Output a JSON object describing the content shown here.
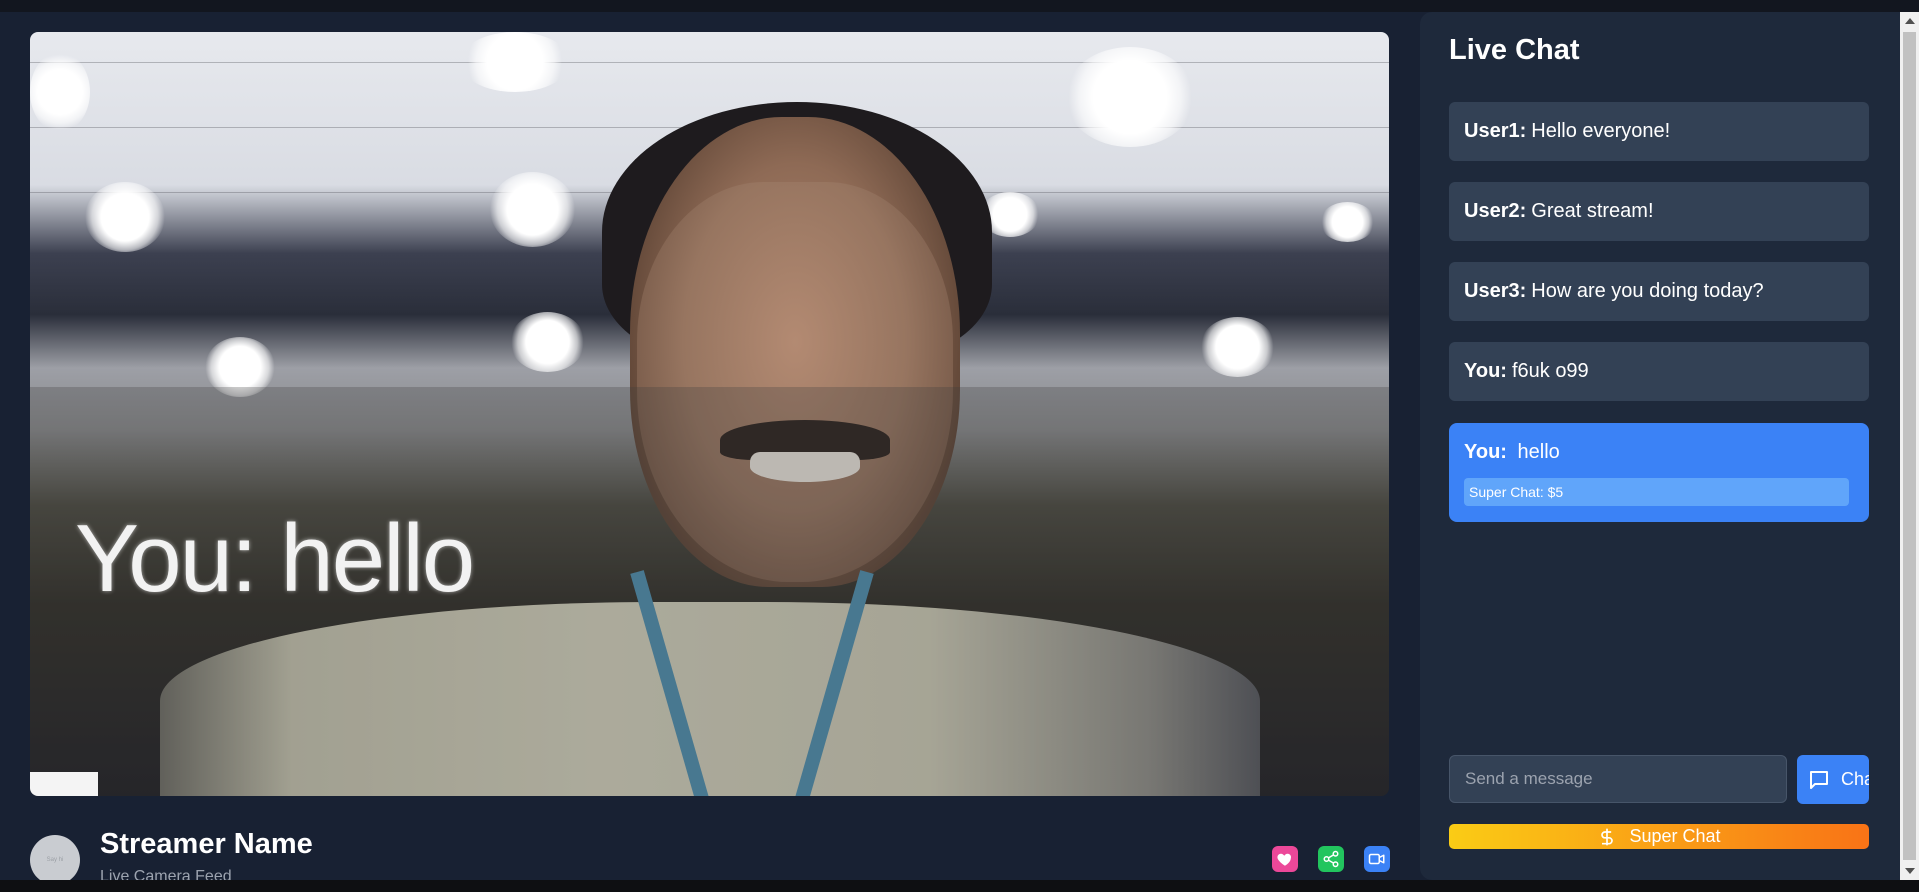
{
  "video": {
    "overlay_text": "You: hello"
  },
  "streamer": {
    "avatar_text": "Say hi",
    "name": "Streamer Name",
    "subtitle": "Live Camera Feed"
  },
  "actions": [
    {
      "icon": "heart-icon",
      "color": "#ec4899"
    },
    {
      "icon": "share-icon",
      "color": "#22c55e"
    },
    {
      "icon": "video-icon",
      "color": "#3b82f6"
    }
  ],
  "chat": {
    "title": "Live Chat",
    "messages": [
      {
        "user": "User1:",
        "text": "Hello everyone!"
      },
      {
        "user": "User2:",
        "text": "Great stream!"
      },
      {
        "user": "User3:",
        "text": "How are you doing today?"
      },
      {
        "user": "You:",
        "text": "f6uk o99"
      }
    ],
    "super_message": {
      "user": "You:",
      "text": "hello",
      "badge": "Super Chat: $5"
    },
    "input_placeholder": "Send a message",
    "send_label": "Chat",
    "superchat_label": "Super Chat"
  },
  "colors": {
    "accent": "#3b82f6",
    "panel": "#1e293b",
    "message_bg": "#334155",
    "superchat_gradient": [
      "#facc15",
      "#f97316"
    ]
  }
}
